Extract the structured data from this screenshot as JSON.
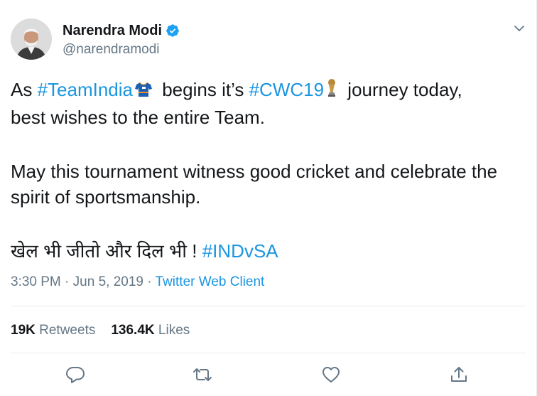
{
  "author": {
    "display_name": "Narendra Modi",
    "handle": "@narendramodi",
    "verified": true
  },
  "tweet": {
    "line1": {
      "t1": "As ",
      "h1": "#TeamIndia",
      "t2": " begins it’s ",
      "h2": "#CWC19",
      "t3": " journey today,"
    },
    "line2": "best wishes to the entire Team.",
    "para2": "May this tournament witness good cricket and celebrate the spirit of sportsmanship.",
    "line3": {
      "text": "खेल भी जीतो और दिल भी ! ",
      "hashtag": "#INDvSA"
    },
    "emoji": [
      "jersey-emoji",
      "trophy-emoji"
    ]
  },
  "meta": {
    "time": "3:30 PM",
    "sep1": " · ",
    "date": "Jun 5, 2019",
    "sep2": " · ",
    "client": "Twitter Web Client"
  },
  "stats": {
    "retweets_count": "19K",
    "retweets_label": "Retweets",
    "likes_count": "136.4K",
    "likes_label": "Likes"
  },
  "actions": [
    "reply-icon",
    "retweet-icon",
    "like-icon",
    "share-icon"
  ],
  "colors": {
    "link": "#1b95e0",
    "text": "#14171a",
    "muted": "#657786",
    "divider": "#e6ecf0",
    "verified": "#1da1f2"
  }
}
